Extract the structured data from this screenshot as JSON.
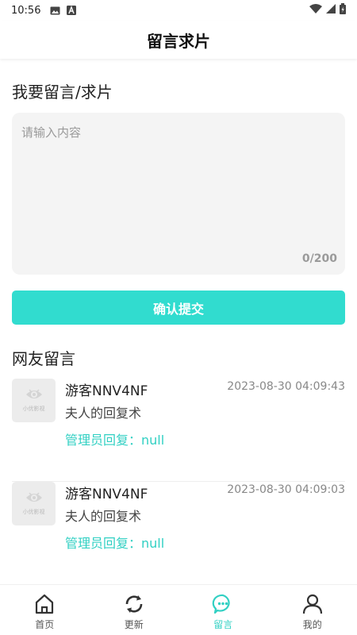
{
  "status_bar": {
    "time": "10:56"
  },
  "header": {
    "title": "留言求片"
  },
  "compose": {
    "title": "我要留言/求片",
    "placeholder": "请输入内容",
    "value": "",
    "char_count": "0/200",
    "submit_label": "确认提交"
  },
  "comments": {
    "title": "网友留言",
    "avatar_caption": "小优影视",
    "items": [
      {
        "user": "游客NNV4NF",
        "time": "2023-08-30 04:09:43",
        "content": "夫人的回复术",
        "reply": "管理员回复：null"
      },
      {
        "user": "游客NNV4NF",
        "time": "2023-08-30 04:09:03",
        "content": "夫人的回复术",
        "reply": "管理员回复：null"
      }
    ]
  },
  "nav": {
    "items": [
      {
        "label": "首页",
        "icon": "home-icon"
      },
      {
        "label": "更新",
        "icon": "refresh-icon"
      },
      {
        "label": "留言",
        "icon": "message-icon"
      },
      {
        "label": "我的",
        "icon": "user-icon"
      }
    ],
    "active_index": 2
  },
  "colors": {
    "accent": "#31dccf",
    "reply_text": "#31d0c3",
    "input_bg": "#f4f4f4"
  }
}
